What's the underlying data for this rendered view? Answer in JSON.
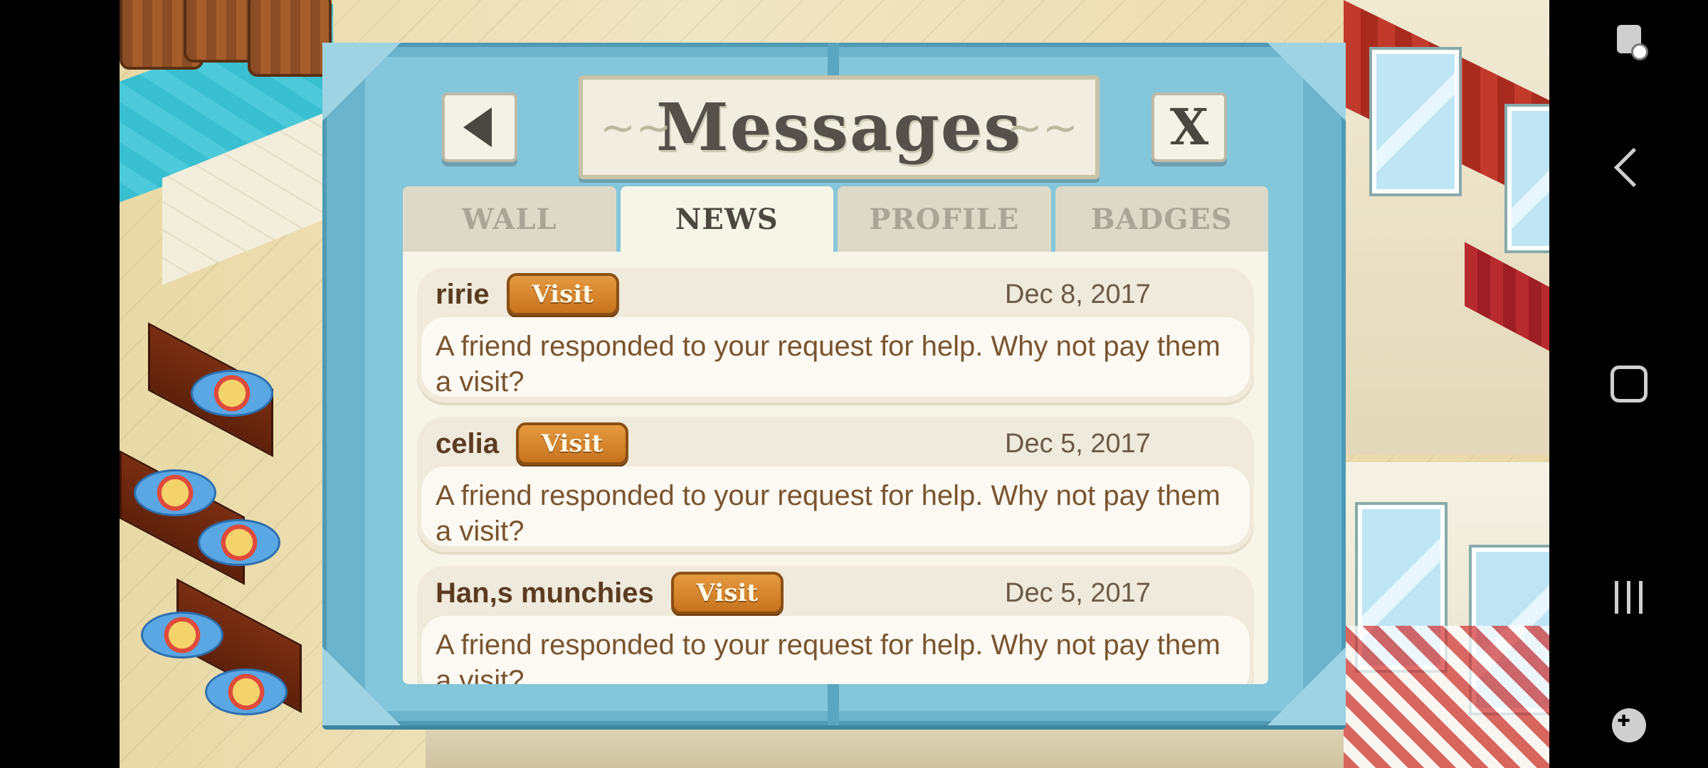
{
  "dialog": {
    "title": "Messages",
    "back_icon": "back-arrow-icon",
    "close_label": "X"
  },
  "tabs": [
    {
      "label": "WALL",
      "active": false
    },
    {
      "label": "NEWS",
      "active": true
    },
    {
      "label": "PROFILE",
      "active": false
    },
    {
      "label": "BADGES",
      "active": false
    }
  ],
  "messages": [
    {
      "sender": "ririe",
      "visit_label": "Visit",
      "date": "Dec 8, 2017",
      "text": "A friend responded to your request for help. Why not pay them a visit?"
    },
    {
      "sender": "celia",
      "visit_label": "Visit",
      "date": "Dec 5, 2017",
      "text": "A friend responded to your request for help. Why not pay them a visit?"
    },
    {
      "sender": "Han,s munchies",
      "visit_label": "Visit",
      "date": "Dec 5, 2017",
      "text": "A friend responded to your request for help. Why not pay them a visit?"
    }
  ],
  "nav": {
    "top_icon": "accessibility-icon",
    "back_icon": "nav-back-icon",
    "home_icon": "nav-home-icon",
    "recents_icon": "nav-recents-icon",
    "game_icon": "game-tools-icon"
  },
  "colors": {
    "dialog_frame": "#6cb4cc",
    "panel_bg": "#f7f4e8",
    "visit_button": "#d9842c",
    "sender_text": "#5b3b22",
    "body_text": "#7a5430"
  }
}
